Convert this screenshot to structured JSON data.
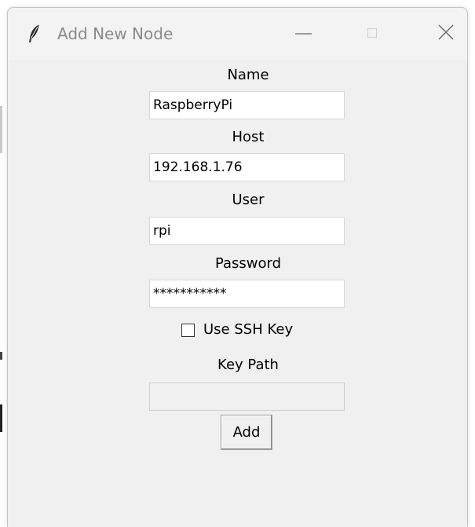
{
  "window": {
    "title": "Add New Node",
    "icon": "feather-icon",
    "controls": [
      "minimize-icon",
      "maximize-icon",
      "close-icon"
    ]
  },
  "form": {
    "name_label": "Name",
    "name_value": "RaspberryPi",
    "host_label": "Host",
    "host_value": "192.168.1.76",
    "user_label": "User",
    "user_value": "rpi",
    "password_label": "Password",
    "password_value": "***********",
    "ssh_key_label": "Use SSH Key",
    "ssh_key_checked": false,
    "key_path_label": "Key Path",
    "key_path_value": "",
    "add_label": "Add"
  },
  "colors": {
    "window_bg": "#f0f0f0",
    "input_bg": "#ffffff",
    "title_text": "#8a8a8a"
  }
}
